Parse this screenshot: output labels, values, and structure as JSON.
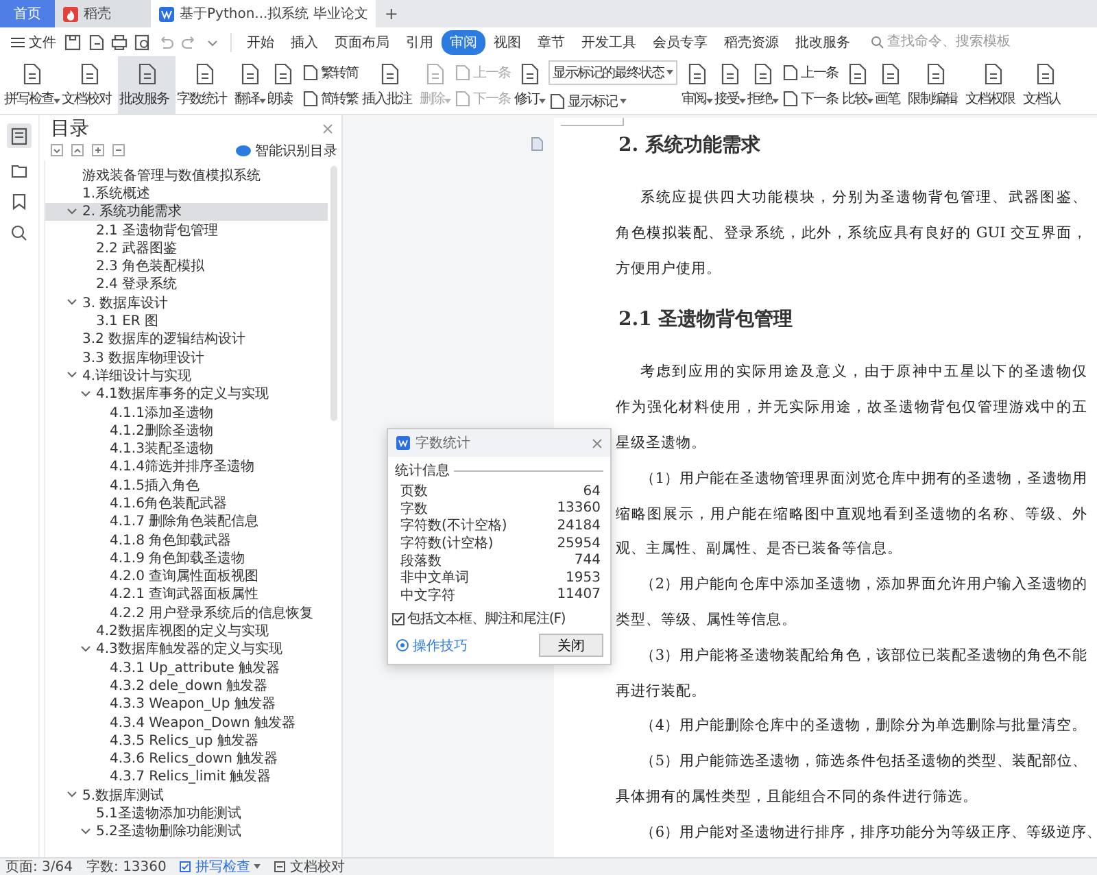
{
  "title_tabs": [
    {
      "label": "首页",
      "kind": "home",
      "selected": false
    },
    {
      "label": "稻壳",
      "kind": "app",
      "selected": false
    },
    {
      "label": "基于Python...拟系统 毕业论文",
      "kind": "doc",
      "selected": true
    }
  ],
  "new_tab": "+",
  "menu": {
    "file": "文件",
    "tabs": [
      {
        "label": "开始",
        "selected": false
      },
      {
        "label": "插入",
        "selected": false
      },
      {
        "label": "页面布局",
        "selected": false
      },
      {
        "label": "引用",
        "selected": false
      },
      {
        "label": "审阅",
        "selected": true
      },
      {
        "label": "视图",
        "selected": false
      },
      {
        "label": "章节",
        "selected": false
      },
      {
        "label": "开发工具",
        "selected": false
      },
      {
        "label": "会员专享",
        "selected": false
      },
      {
        "label": "稻壳资源",
        "selected": false
      },
      {
        "label": "批改服务",
        "selected": false
      }
    ],
    "search": {
      "placeholder": "查找命令、搜索模板"
    }
  },
  "ribbon": [
    {
      "kind": "big",
      "label": "拼写检查",
      "dropdown": true,
      "active": false,
      "disabled": false
    },
    {
      "kind": "big",
      "label": "文档校对",
      "dropdown": false,
      "active": false,
      "disabled": false
    },
    {
      "kind": "big",
      "label": "批改服务",
      "dropdown": false,
      "active": true,
      "disabled": false
    },
    {
      "kind": "big",
      "label": "字数统计",
      "dropdown": false,
      "active": false,
      "disabled": false
    },
    {
      "kind": "big",
      "label": "翻译",
      "dropdown": true,
      "active": false,
      "disabled": false
    },
    {
      "kind": "big",
      "label": "朗读",
      "dropdown": false,
      "active": false,
      "disabled": false
    },
    {
      "kind": "stack",
      "items": [
        {
          "label": "繁转简",
          "disabled": false
        },
        {
          "label": "简转繁",
          "disabled": false
        }
      ]
    },
    {
      "kind": "big",
      "label": "插入批注",
      "dropdown": false,
      "active": false,
      "disabled": false
    },
    {
      "kind": "big",
      "label": "删除",
      "dropdown": true,
      "active": false,
      "disabled": true
    },
    {
      "kind": "stack",
      "items": [
        {
          "label": "上一条",
          "disabled": true
        },
        {
          "label": "下一条",
          "disabled": true
        }
      ]
    },
    {
      "kind": "big",
      "label": "修订",
      "dropdown": true,
      "active": false,
      "disabled": false
    },
    {
      "kind": "markup",
      "value": "显示标记的最终状态",
      "label": "显示标记"
    },
    {
      "kind": "big",
      "label": "审阅",
      "dropdown": true,
      "active": false,
      "disabled": false
    },
    {
      "kind": "big",
      "label": "接受",
      "dropdown": true,
      "active": false,
      "disabled": false
    },
    {
      "kind": "big",
      "label": "拒绝",
      "dropdown": true,
      "active": false,
      "disabled": false
    },
    {
      "kind": "stack",
      "items": [
        {
          "label": "上一条",
          "disabled": false
        },
        {
          "label": "下一条",
          "disabled": false
        }
      ]
    },
    {
      "kind": "big",
      "label": "比较",
      "dropdown": true,
      "active": false,
      "disabled": false
    },
    {
      "kind": "big",
      "label": "画笔",
      "dropdown": false,
      "active": false,
      "disabled": false
    },
    {
      "kind": "big",
      "label": "限制编辑",
      "dropdown": false,
      "active": false,
      "disabled": false
    },
    {
      "kind": "big",
      "label": "文档权限",
      "dropdown": false,
      "active": false,
      "disabled": false
    },
    {
      "kind": "big",
      "label": "文档认",
      "dropdown": false,
      "active": false,
      "disabled": false
    }
  ],
  "outline": {
    "title": "目录",
    "smart_button": "智能识别目录",
    "items": [
      {
        "label": "游戏装备管理与数值模拟系统",
        "selected": false
      },
      {
        "label": "1.系统概述",
        "selected": false
      },
      {
        "label": "2. 系统功能需求",
        "selected": true,
        "expanded": true,
        "children": [
          {
            "label": "2.1 圣遗物背包管理",
            "selected": false
          },
          {
            "label": "2.2 武器图鉴",
            "selected": false
          },
          {
            "label": "2.3 角色装配模拟",
            "selected": false
          },
          {
            "label": "2.4 登录系统",
            "selected": false
          }
        ]
      },
      {
        "label": "3. 数据库设计",
        "selected": false,
        "expanded": true,
        "children": [
          {
            "label": "3.1 ER 图",
            "selected": false
          }
        ]
      },
      {
        "label": "3.2 数据库的逻辑结构设计",
        "selected": false
      },
      {
        "label": "3.3 数据库物理设计",
        "selected": false
      },
      {
        "label": "4.详细设计与实现",
        "selected": false,
        "expanded": true,
        "children": [
          {
            "label": "4.1数据库事务的定义与实现",
            "selected": false,
            "expanded": true,
            "children": [
              {
                "label": "4.1.1添加圣遗物",
                "selected": false
              },
              {
                "label": "4.1.2删除圣遗物",
                "selected": false
              },
              {
                "label": "4.1.3装配圣遗物",
                "selected": false
              },
              {
                "label": "4.1.4筛选并排序圣遗物",
                "selected": false
              },
              {
                "label": "4.1.5插入角色",
                "selected": false
              },
              {
                "label": "4.1.6角色装配武器",
                "selected": false
              },
              {
                "label": "4.1.7  删除角色装配信息",
                "selected": false
              },
              {
                "label": "4.1.8 角色卸载武器",
                "selected": false
              },
              {
                "label": "4.1.9 角色卸载圣遗物",
                "selected": false
              },
              {
                "label": "4.2.0 查询属性面板视图",
                "selected": false
              },
              {
                "label": "4.2.1 查询武器面板属性",
                "selected": false
              },
              {
                "label": "4.2.2 用户登录系统后的信息恢复",
                "selected": false
              }
            ]
          },
          {
            "label": "4.2数据库视图的定义与实现",
            "selected": false
          },
          {
            "label": "4.3数据库触发器的定义与实现",
            "selected": false,
            "expanded": true,
            "children": [
              {
                "label": "4.3.1 Up_attribute 触发器",
                "selected": false
              },
              {
                "label": "4.3.2 dele_down 触发器",
                "selected": false
              },
              {
                "label": "4.3.3 Weapon_Up 触发器",
                "selected": false
              },
              {
                "label": "4.3.4 Weapon_Down 触发器",
                "selected": false
              },
              {
                "label": "4.3.5 Relics_up 触发器",
                "selected": false
              },
              {
                "label": "4.3.6 Relics_down 触发器",
                "selected": false
              },
              {
                "label": "4.3.7 Relics_limit 触发器",
                "selected": false
              }
            ]
          }
        ]
      },
      {
        "label": "5.数据库测试",
        "selected": false,
        "expanded": true,
        "children": [
          {
            "label": "5.1圣遗物添加功能测试",
            "selected": false
          },
          {
            "label": "5.2圣遗物删除功能测试",
            "selected": false,
            "expanded": true
          }
        ]
      }
    ]
  },
  "document": [
    {
      "kind": "heading",
      "text": "2.  系统功能需求"
    },
    {
      "kind": "para",
      "lines": [
        "系统应提供四大功能模块，分别为圣遗物背包管理、武器图鉴、",
        "角色模拟装配、登录系统，此外，系统应具有良好的 GUI 交互界面，",
        "方便用户使用。"
      ]
    },
    {
      "kind": "heading",
      "text": "2.1 圣遗物背包管理"
    },
    {
      "kind": "para",
      "lines": [
        "考虑到应用的实际用途及意义，由于原神中五星以下的圣遗物仅",
        "作为强化材料使用，并无实际用途，故圣遗物背包仅管理游戏中的五",
        "星级圣遗物。"
      ]
    },
    {
      "kind": "para",
      "lines": [
        "（1）用户能在圣遗物管理界面浏览仓库中拥有的圣遗物，圣遗物用",
        "缩略图展示，用户能在缩略图中直观地看到圣遗物的名称、等级、外",
        "观、主属性、副属性、是否已装备等信息。"
      ]
    },
    {
      "kind": "para",
      "lines": [
        "（2）用户能向仓库中添加圣遗物，添加界面允许用户输入圣遗物的",
        "类型、等级、属性等信息。"
      ]
    },
    {
      "kind": "para",
      "lines": [
        "（3）用户能将圣遗物装配给角色，该部位已装配圣遗物的角色不能",
        "再进行装配。"
      ]
    },
    {
      "kind": "para",
      "lines": [
        "（4）用户能删除仓库中的圣遗物，删除分为单选删除与批量清空。"
      ]
    },
    {
      "kind": "para",
      "lines": [
        "（5）用户能筛选圣遗物，筛选条件包括圣遗物的类型、装配部位、",
        "具体拥有的属性类型，且能组合不同的条件进行筛选。"
      ]
    },
    {
      "kind": "para",
      "lines": [
        "（6）用户能对圣遗物进行排序，排序功能分为等级正序、等级逆序、"
      ]
    }
  ],
  "dialog": {
    "title": "字数统计",
    "section": "统计信息",
    "rows": [
      {
        "label": "页数",
        "value": "64"
      },
      {
        "label": "字数",
        "value": "13360"
      },
      {
        "label": "字符数(不计空格)",
        "value": "24184"
      },
      {
        "label": "字符数(计空格)",
        "value": "25954"
      },
      {
        "label": "段落数",
        "value": "744"
      },
      {
        "label": "非中文单词",
        "value": "1953"
      },
      {
        "label": "中文字符",
        "value": "11407"
      }
    ],
    "include": {
      "label": "包括文本框、脚注和尾注(F)",
      "checked": true
    },
    "tips": "操作技巧",
    "close": "关闭"
  },
  "status_bar": {
    "page": "页面: 3/64",
    "words": "字数: 13360",
    "spell": {
      "label": "拼写检查",
      "checked": true
    },
    "proof": "文档校对"
  }
}
